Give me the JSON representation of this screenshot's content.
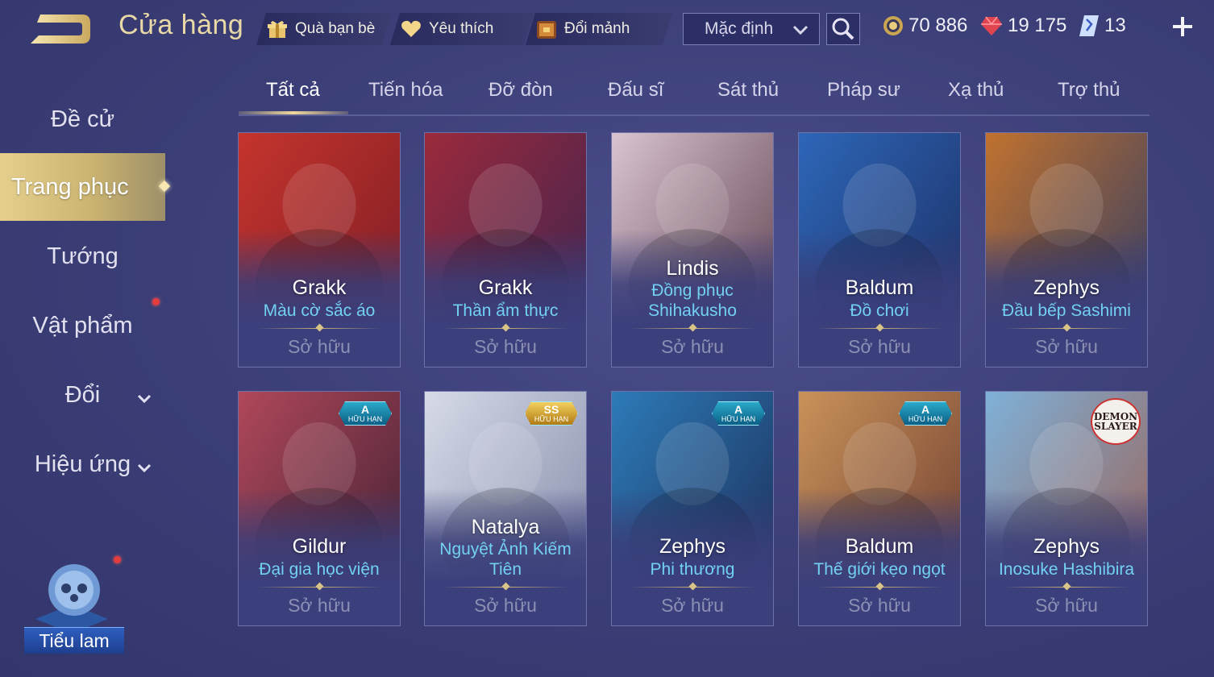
{
  "header": {
    "title": "Cửa hàng",
    "buttons": {
      "gift": "Quà bạn bè",
      "favorite": "Yêu thích",
      "exchange_fragments": "Đổi mảnh"
    },
    "sort": {
      "selected": "Mặc định"
    },
    "currency": {
      "gold": "70 886",
      "ruby": "19 175",
      "voucher": "13"
    }
  },
  "sidebar": {
    "items": [
      {
        "label": "Đề cử",
        "active": false
      },
      {
        "label": "Trang phục",
        "active": true
      },
      {
        "label": "Tướng",
        "active": false
      },
      {
        "label": "Vật phẩm",
        "active": false,
        "notification": true
      },
      {
        "label": "Đổi",
        "active": false,
        "expandable": true
      },
      {
        "label": "Hiệu ứng",
        "active": false,
        "expandable": true
      }
    ],
    "mascot_label": "Tiểu lam"
  },
  "tabs": [
    "Tất cả",
    "Tiến hóa",
    "Đỡ đòn",
    "Đấu sĩ",
    "Sát thủ",
    "Pháp sư",
    "Xạ thủ",
    "Trợ thủ"
  ],
  "active_tab": 0,
  "cards": [
    {
      "hero": "Grakk",
      "skin": "Màu cờ sắc áo",
      "status": "Sở hữu",
      "palette": [
        "#c5342d",
        "#7a1c25"
      ]
    },
    {
      "hero": "Grakk",
      "skin": "Thần ẩm thực",
      "status": "Sở hữu",
      "palette": [
        "#9b2a3c",
        "#3b2350"
      ]
    },
    {
      "hero": "Lindis",
      "skin": "Đồng phục Shihakusho",
      "status": "Sở hữu",
      "palette": [
        "#d9c4d0",
        "#5a3b4a"
      ]
    },
    {
      "hero": "Baldum",
      "skin": "Đồ chơi",
      "status": "Sở hữu",
      "palette": [
        "#2e66b8",
        "#1b2d60"
      ]
    },
    {
      "hero": "Zephys",
      "skin": "Đầu bếp Sashimi",
      "status": "Sở hữu",
      "palette": [
        "#c1722f",
        "#2b3a66"
      ]
    },
    {
      "hero": "Gildur",
      "skin": "Đại gia học viện",
      "status": "Sở hữu",
      "palette": [
        "#b0485a",
        "#3d1f32"
      ],
      "badge": {
        "tier": "A",
        "limited": "HỮU HẠN",
        "color": "#2aa9c9"
      }
    },
    {
      "hero": "Natalya",
      "skin": "Nguyệt Ảnh Kiếm Tiên",
      "status": "Sở hữu",
      "palette": [
        "#d7dbe8",
        "#7f87a6"
      ],
      "badge": {
        "tier": "SS",
        "limited": "HỮU HẠN",
        "color": "#f3cf5e"
      }
    },
    {
      "hero": "Zephys",
      "skin": "Phi thương",
      "status": "Sở hữu",
      "palette": [
        "#2d7bb8",
        "#1b2b55"
      ],
      "badge": {
        "tier": "A",
        "limited": "HỮU HẠN",
        "color": "#2aa9c9"
      }
    },
    {
      "hero": "Baldum",
      "skin": "Thế giới kẹo ngọt",
      "status": "Sở hữu",
      "palette": [
        "#c9925a",
        "#6a3a2e"
      ],
      "badge": {
        "tier": "A",
        "limited": "HỮU HẠN",
        "color": "#2aa9c9"
      }
    },
    {
      "hero": "Zephys",
      "skin": "Inosuke Hashibira",
      "status": "Sở hữu",
      "palette": [
        "#7fb1d9",
        "#9b5f52"
      ],
      "collab": "DEMON SLAYER"
    }
  ]
}
